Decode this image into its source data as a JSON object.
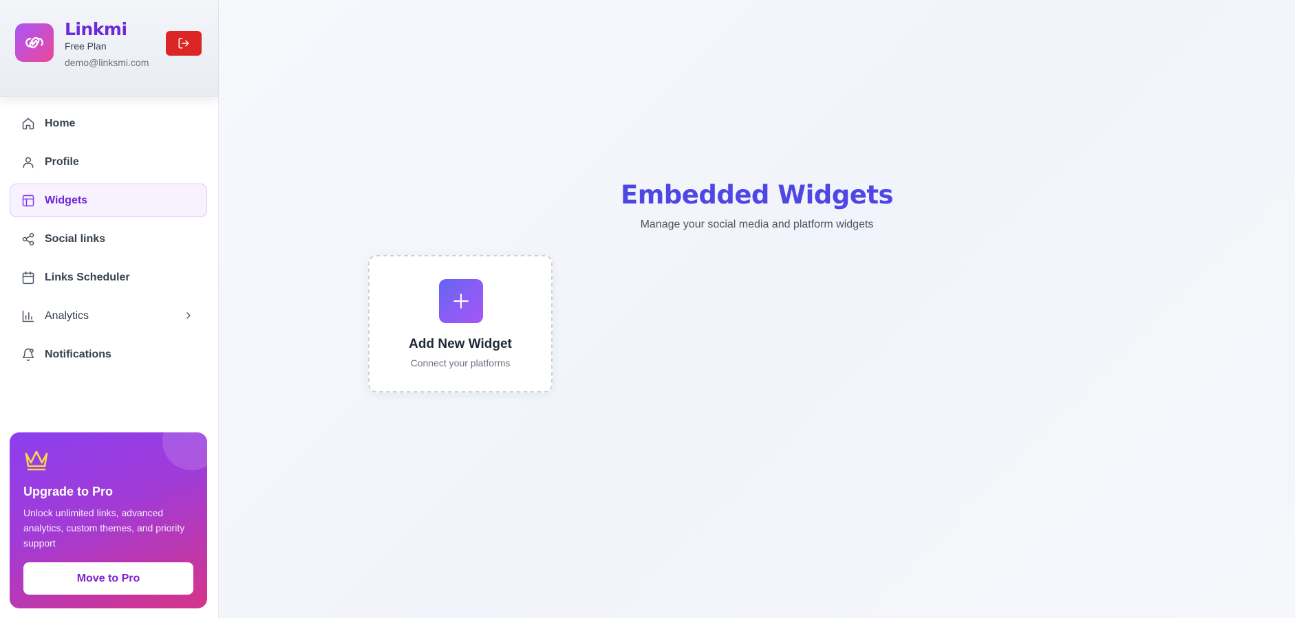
{
  "brand": {
    "name": "Linkmi",
    "plan": "Free Plan",
    "email": "demo@linksmi.com"
  },
  "sidebar": {
    "items": [
      {
        "label": "Home",
        "icon": "home-icon"
      },
      {
        "label": "Profile",
        "icon": "user-icon"
      },
      {
        "label": "Widgets",
        "icon": "layout-icon",
        "active": true
      },
      {
        "label": "Social links",
        "icon": "share-icon"
      },
      {
        "label": "Links Scheduler",
        "icon": "calendar-icon"
      },
      {
        "label": "Analytics",
        "icon": "bar-chart-icon",
        "has_submenu": true
      },
      {
        "label": "Notifications",
        "icon": "bell-icon"
      }
    ]
  },
  "promo": {
    "title": "Upgrade to Pro",
    "description": "Unlock unlimited links, advanced analytics, custom themes, and priority support",
    "button_label": "Move to Pro"
  },
  "main": {
    "title": "Embedded Widgets",
    "subtitle": "Manage your social media and platform widgets",
    "add_card": {
      "title": "Add New Widget",
      "subtitle": "Connect your platforms"
    }
  },
  "colors": {
    "accent": "#6d28d9",
    "title": "#4f46e5",
    "logout": "#dc2626",
    "promo_start": "#8b3ff0",
    "promo_end": "#d63489",
    "crown": "#fcd34d"
  }
}
